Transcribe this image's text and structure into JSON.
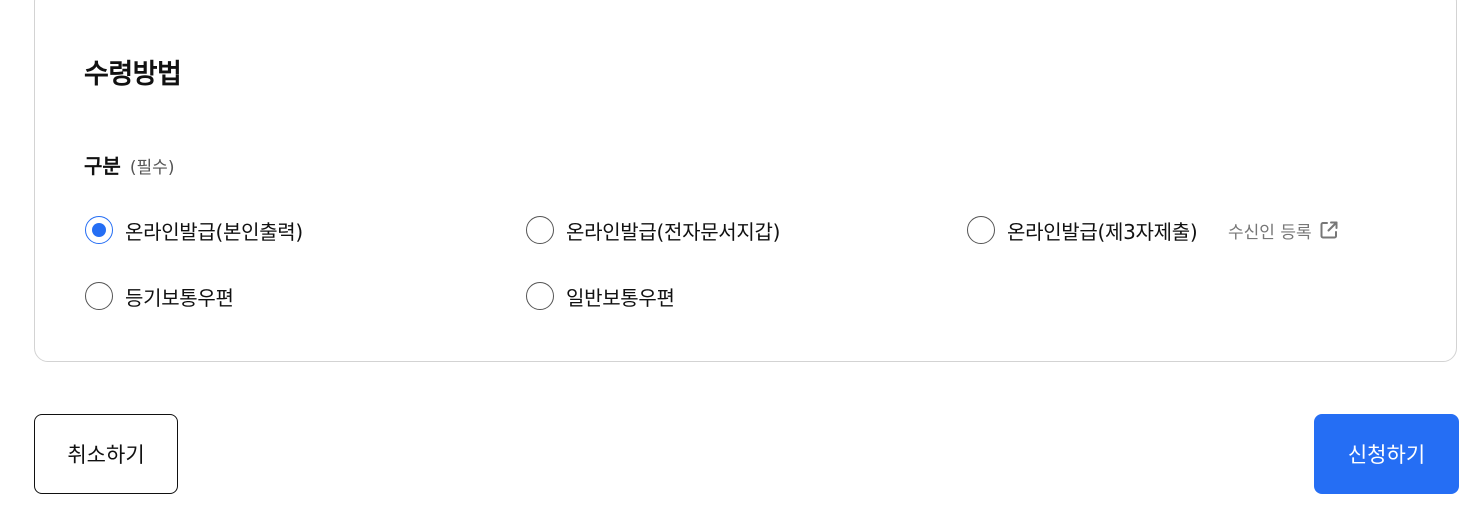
{
  "section": {
    "title": "수령방법"
  },
  "field": {
    "label": "구분",
    "required": "(필수)"
  },
  "options": [
    {
      "label": "온라인발급(본인출력)",
      "checked": true
    },
    {
      "label": "온라인발급(전자문서지갑)",
      "checked": false
    },
    {
      "label": "온라인발급(제3자제출)",
      "checked": false
    },
    {
      "label": "등기보통우편",
      "checked": false
    },
    {
      "label": "일반보통우편",
      "checked": false
    }
  ],
  "recipient_link": {
    "label": "수신인 등록",
    "icon": "external-link-icon"
  },
  "buttons": {
    "cancel": "취소하기",
    "submit": "신청하기"
  },
  "colors": {
    "accent": "#256ef4",
    "border": "#d3d3d3",
    "muted_text": "#777777"
  }
}
